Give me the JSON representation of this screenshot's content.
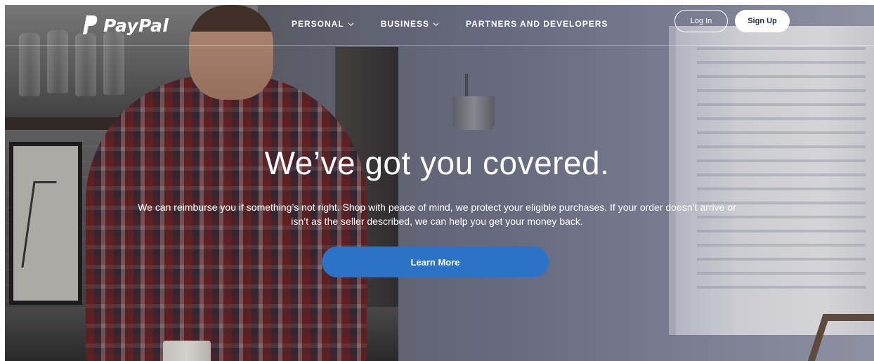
{
  "brand": {
    "name": "PayPal",
    "colors": {
      "accent_blue": "#2a73c6",
      "white": "#ffffff",
      "signup_text": "#1c2a4a"
    }
  },
  "header": {
    "logo_icon": "paypal-p-icon",
    "nav": [
      {
        "label": "PERSONAL",
        "has_dropdown": true,
        "icon": "chevron-down-icon"
      },
      {
        "label": "BUSINESS",
        "has_dropdown": true,
        "icon": "chevron-down-icon"
      },
      {
        "label": "PARTNERS AND DEVELOPERS",
        "has_dropdown": false
      }
    ],
    "login_label": "Log In",
    "signup_label": "Sign Up"
  },
  "hero": {
    "title": "We’ve got you covered.",
    "description": "We can reimburse you if something’s not right. Shop with peace of mind, we protect your eligible purchases. If your order doesn’t arrive or isn’t as the seller described, we can help you get your money back.",
    "cta_label": "Learn More"
  }
}
